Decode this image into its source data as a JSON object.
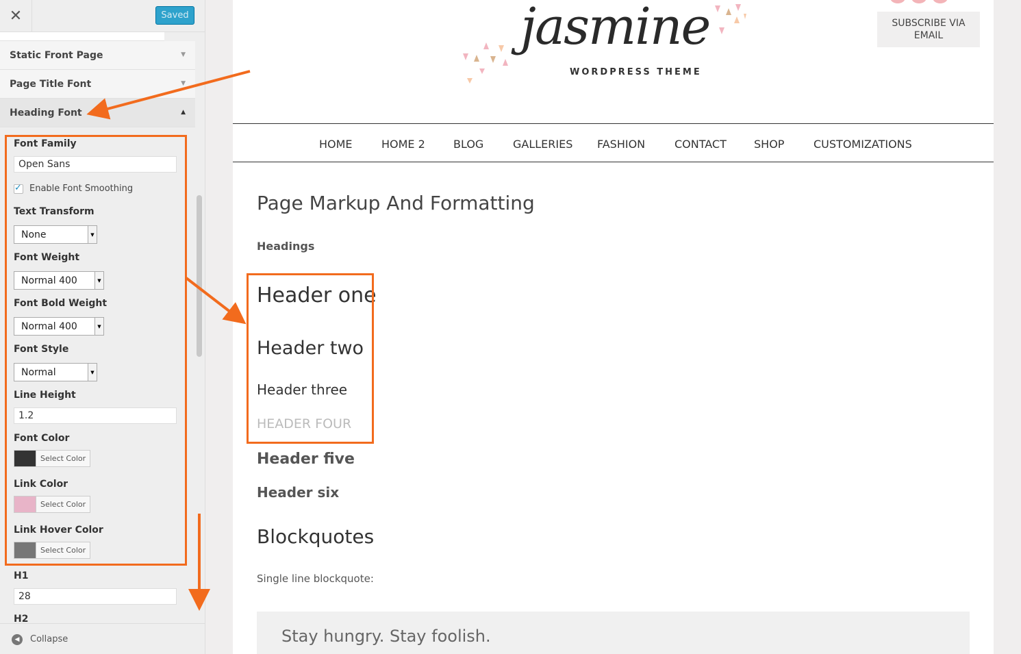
{
  "sidebar": {
    "close_icon": "close-icon",
    "saved_label": "Saved",
    "sections": [
      {
        "label": "Static Front Page"
      },
      {
        "label": "Page Title Font"
      },
      {
        "label": "Heading Font"
      }
    ],
    "panel": {
      "font_family_label": "Font Family",
      "font_family_value": "Open Sans",
      "smoothing_label": "Enable Font Smoothing",
      "smoothing_checked": true,
      "text_transform_label": "Text Transform",
      "text_transform_value": "None",
      "font_weight_label": "Font Weight",
      "font_weight_value": "Normal 400",
      "bold_weight_label": "Font Bold Weight",
      "bold_weight_value": "Normal 400",
      "font_style_label": "Font Style",
      "font_style_value": "Normal",
      "line_height_label": "Line Height",
      "line_height_value": "1.2",
      "font_color_label": "Font Color",
      "font_color": "#333333",
      "link_color_label": "Link Color",
      "link_color": "#e8b4c8",
      "link_hover_label": "Link Hover Color",
      "link_hover_color": "#777777",
      "select_color_label": "Select Color",
      "h1_label": "H1",
      "h1_value": "28",
      "h2_label": "H2"
    },
    "collapse_label": "Collapse"
  },
  "preview": {
    "logo_script": "jasmine",
    "logo_sub": "WORDPRESS THEME",
    "subscribe_label": "SUBSCRIBE VIA EMAIL",
    "nav": [
      "HOME",
      "HOME 2",
      "BLOG",
      "GALLERIES",
      "FASHION",
      "CONTACT",
      "SHOP",
      "CUSTOMIZATIONS"
    ],
    "page_title": "Page Markup And Formatting",
    "headings_label": "Headings",
    "h1": "Header one",
    "h2": "Header two",
    "h3": "Header three",
    "h4": "HEADER FOUR",
    "h5": "Header five",
    "h6": "Header six",
    "blockquotes_title": "Blockquotes",
    "single_line_label": "Single line blockquote:",
    "quote": "Stay hungry. Stay foolish."
  },
  "colors": {
    "accent_orange": "#f26b1d",
    "saved_blue": "#2ea2cc"
  }
}
